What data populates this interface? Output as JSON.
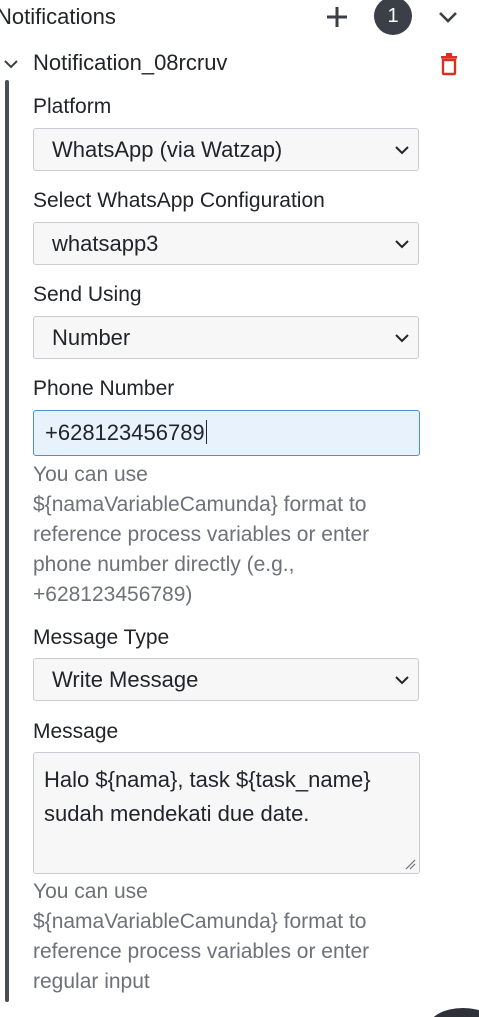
{
  "header": {
    "title": "Notifications",
    "count": "1",
    "add_icon": "plus-icon",
    "collapse_icon": "chevron-down-icon"
  },
  "entry": {
    "title": "Notification_08rcruv",
    "expand_icon": "chevron-down-icon",
    "delete_icon": "trash-icon",
    "delete_color": "#d93025"
  },
  "form": {
    "platform": {
      "label": "Platform",
      "value": "WhatsApp (via Watzap)"
    },
    "whatsapp_config": {
      "label": "Select WhatsApp Configuration",
      "value": "whatsapp3"
    },
    "send_using": {
      "label": "Send Using",
      "value": "Number"
    },
    "phone_number": {
      "label": "Phone Number",
      "value": "+628123456789",
      "help_lines": [
        "You can use",
        "${namaVariableCamunda} format to",
        "reference process variables or enter",
        "phone number directly (e.g.,",
        "+628123456789)"
      ]
    },
    "message_type": {
      "label": "Message Type",
      "value": "Write Message"
    },
    "message": {
      "label": "Message",
      "value_lines": [
        "Halo ${nama}, task ${task_name}",
        "sudah mendekati due date."
      ],
      "help_lines": [
        "You can use",
        "${namaVariableCamunda} format to",
        "reference process variables or enter",
        "regular input"
      ]
    }
  },
  "colors": {
    "accent_focus": "#4a8ee0",
    "badge_bg": "#3b3f47",
    "rail": "#4b4e55"
  }
}
